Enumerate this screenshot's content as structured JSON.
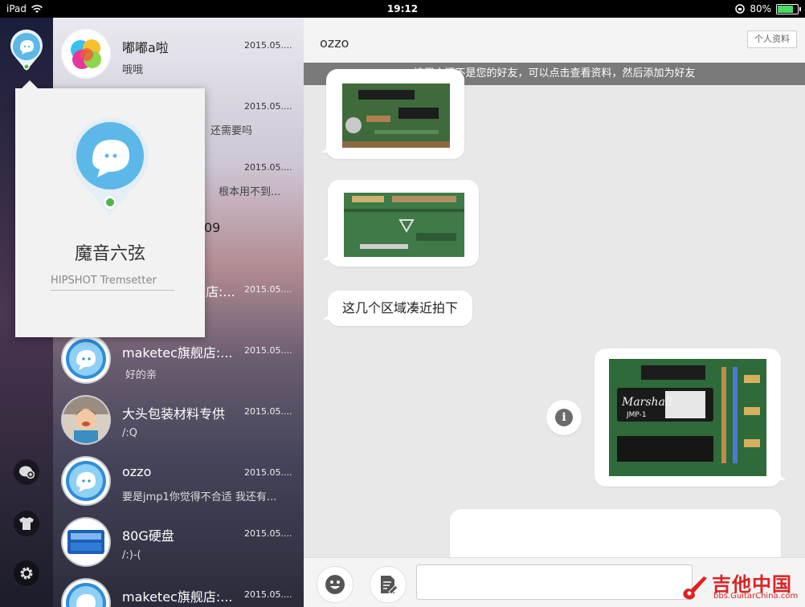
{
  "status_bar": {
    "device": "iPad",
    "time": "19:12",
    "battery": "80%",
    "battery_fraction": 0.8
  },
  "rail": {
    "icons": [
      "chat-plus-icon",
      "shirt-icon",
      "gear-icon"
    ]
  },
  "conversations": [
    {
      "name": "嘟嘟a啦",
      "date": "2015.05....",
      "preview": "哦哦",
      "avatar": "colorful-balls"
    },
    {
      "name": "",
      "date": "2015.05....",
      "preview": "还需要吗",
      "avatar": "hidden"
    },
    {
      "name": "",
      "date": "2015.05....",
      "preview": "根本用不到...",
      "avatar": "hidden"
    },
    {
      "name": "09",
      "date": "",
      "preview": "",
      "avatar": "hidden"
    },
    {
      "name": "店:...",
      "date": "2015.05....",
      "preview": "",
      "avatar": "hidden"
    },
    {
      "name": "maketec旗舰店:...",
      "date": "2015.05....",
      "preview": "好的亲",
      "avatar": "qq-bubble"
    },
    {
      "name": "大头包装材料专供",
      "date": "2015.05....",
      "preview": "/:Q",
      "avatar": "child-photo"
    },
    {
      "name": "ozzo",
      "date": "2015.05....",
      "preview": "要是jmp1你觉得不合适 我还有...",
      "avatar": "qq-bubble"
    },
    {
      "name": "80G硬盘",
      "date": "2015.05....",
      "preview": "/:)-(",
      "avatar": "blue-badge"
    },
    {
      "name": "maketec旗舰店:...",
      "date": "2015.05....",
      "preview": "",
      "avatar": "qq-bubble"
    }
  ],
  "popup": {
    "name": "魔音六弦",
    "signature": "HIPSHOT Tremsetter"
  },
  "chat": {
    "title": "ozzo",
    "profile_button": "个人资料",
    "notice": "该用户还不是您的好友，可以点击查看资料，然后添加为好友",
    "text_message": "这几个区域凑近拍下",
    "chip_label": "Marshall",
    "chip_model": "JMP-1"
  },
  "input": {
    "placeholder": ""
  },
  "watermark": {
    "title": "吉他中国",
    "url": "bbs.GuitarChina.com"
  },
  "colors": {
    "accent": "#5bb8e8",
    "notice_bg": "#7a7a7a",
    "watermark": "#dd2222"
  }
}
